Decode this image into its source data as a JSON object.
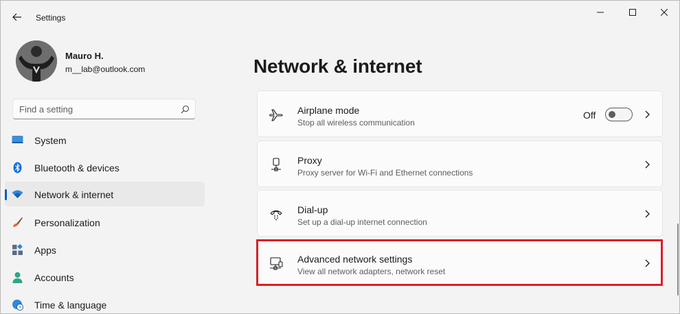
{
  "window": {
    "title": "Settings",
    "accent_color": "#005fb8",
    "highlight_color": "#d81f26"
  },
  "profile": {
    "name": "Mauro H.",
    "email": "m__lab@outlook.com"
  },
  "search": {
    "placeholder": "Find a setting",
    "value": ""
  },
  "sidebar": {
    "items": [
      {
        "label": "System",
        "icon": "monitor-icon",
        "selected": false
      },
      {
        "label": "Bluetooth & devices",
        "icon": "bluetooth-icon",
        "selected": false
      },
      {
        "label": "Network & internet",
        "icon": "wifi-icon",
        "selected": true
      },
      {
        "label": "Personalization",
        "icon": "paintbrush-icon",
        "selected": false
      },
      {
        "label": "Apps",
        "icon": "apps-icon",
        "selected": false
      },
      {
        "label": "Accounts",
        "icon": "person-icon",
        "selected": false
      },
      {
        "label": "Time & language",
        "icon": "globe-clock-icon",
        "selected": false
      }
    ]
  },
  "main": {
    "title": "Network & internet",
    "cards": [
      {
        "title": "Airplane mode",
        "description": "Stop all wireless communication",
        "icon": "airplane-icon",
        "toggle_label": "Off",
        "toggle_on": false
      },
      {
        "title": "Proxy",
        "description": "Proxy server for Wi-Fi and Ethernet connections",
        "icon": "proxy-icon"
      },
      {
        "title": "Dial-up",
        "description": "Set up a dial-up internet connection",
        "icon": "dialup-icon"
      },
      {
        "title": "Advanced network settings",
        "description": "View all network adapters, network reset",
        "icon": "network-adapter-icon",
        "highlighted": true
      }
    ]
  }
}
